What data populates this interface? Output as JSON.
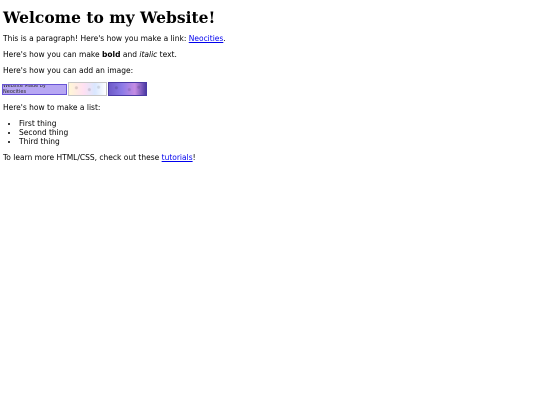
{
  "page": {
    "title": "Welcome to my Website!",
    "para_link": {
      "prefix": "This is a paragraph! Here's how you make a link: ",
      "link_text": "Neocities",
      "suffix": "."
    },
    "para_format": {
      "prefix": "Here's how you can make ",
      "bold": "bold",
      "middle": " and ",
      "italic": "italic",
      "suffix": " text."
    },
    "para_image": "Here's how you can add an image:",
    "images": [
      {
        "label": "Website Made by Neocities"
      },
      {
        "label": "badge-2"
      },
      {
        "label": "badge-3"
      }
    ],
    "para_list": "Here's how to make a list:",
    "list_items": [
      "First thing",
      "Second thing",
      "Third thing"
    ],
    "para_tutorials": {
      "prefix": "To learn more HTML/CSS, check out these ",
      "link_text": "tutorials",
      "suffix": "!"
    }
  }
}
